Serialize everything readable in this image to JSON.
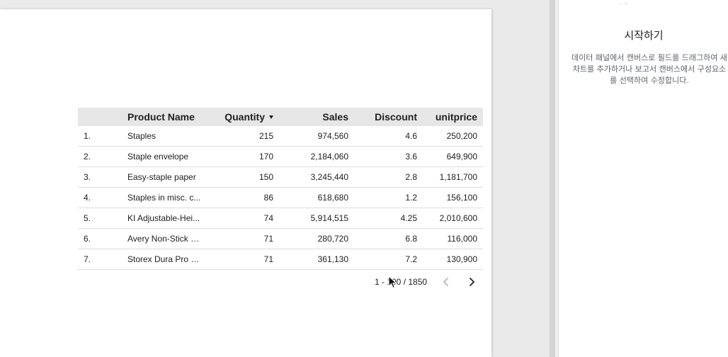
{
  "panel": {
    "title": "시작하기",
    "description": "데이터 패널에서 캔버스로 필드를 드래그하여 새 차트를 추가하거나 보고서 캔버스에서 구성요소를 선택하여 수정합니다."
  },
  "table": {
    "headers": {
      "product_name": "Product Name",
      "quantity": "Quantity",
      "sales": "Sales",
      "discount": "Discount",
      "unitprice": "unitprice"
    },
    "sort": {
      "column": "Quantity",
      "direction": "descending"
    },
    "rows": [
      {
        "idx": "1.",
        "name": "Staples",
        "qty": "215",
        "sales": "974,560",
        "disc": "4.6",
        "unit": "250,200"
      },
      {
        "idx": "2.",
        "name": "Staple envelope",
        "qty": "170",
        "sales": "2,184,060",
        "disc": "3.6",
        "unit": "649,900"
      },
      {
        "idx": "3.",
        "name": "Easy-staple paper",
        "qty": "150",
        "sales": "3,245,440",
        "disc": "2.8",
        "unit": "1,181,700"
      },
      {
        "idx": "4.",
        "name": "Staples in misc. c...",
        "qty": "86",
        "sales": "618,680",
        "disc": "1.2",
        "unit": "156,100"
      },
      {
        "idx": "5.",
        "name": "KI Adjustable-Hei...",
        "qty": "74",
        "sales": "5,914,515",
        "disc": "4.25",
        "unit": "2,010,600"
      },
      {
        "idx": "6.",
        "name": "Avery Non-Stick B...",
        "qty": "71",
        "sales": "280,720",
        "disc": "6.8",
        "unit": "116,000"
      },
      {
        "idx": "7.",
        "name": "Storex Dura Pro B...",
        "qty": "71",
        "sales": "361,130",
        "disc": "7.2",
        "unit": "130,900"
      }
    ]
  },
  "pager": {
    "text": "1 - 100 / 1850",
    "prev_icon": "chevron-left-icon",
    "next_icon": "chevron-right-icon"
  },
  "colors": {
    "header_bg": "#e6e6e6",
    "canvas_bg": "#eaeaea",
    "row_border": "#dcdcdc",
    "disabled_icon": "#b8b8b8"
  }
}
